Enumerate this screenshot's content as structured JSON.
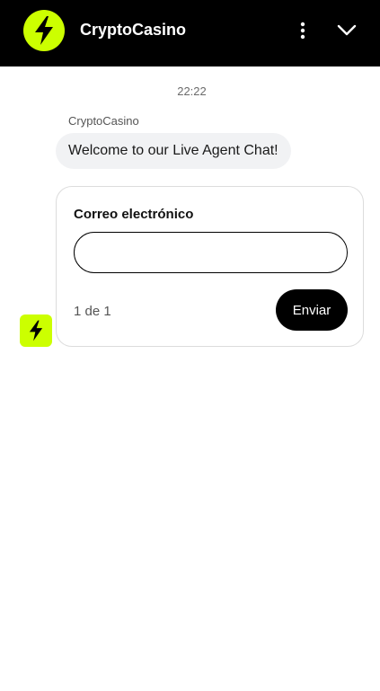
{
  "colors": {
    "brand": "#ccff00",
    "header_bg": "#000000",
    "bubble_bg": "#f1f2f4"
  },
  "header": {
    "title": "CryptoCasino",
    "logo_icon": "lightning-bolt-icon",
    "menu_icon": "more-vertical-icon",
    "collapse_icon": "chevron-down-icon"
  },
  "chat": {
    "timestamp": "22:22",
    "sender": "CryptoCasino",
    "message": "Welcome to our Live Agent Chat!",
    "avatar_icon": "lightning-bolt-icon"
  },
  "form": {
    "field_label": "Correo electrónico",
    "email_value": "",
    "pager": "1 de 1",
    "submit_label": "Enviar"
  }
}
